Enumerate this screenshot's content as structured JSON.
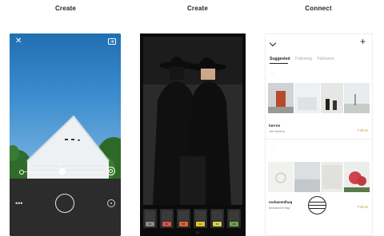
{
  "columns": {
    "create_1": "Create",
    "create_2": "Create",
    "connect": "Connect"
  },
  "camera": {
    "icons": [
      "close-icon",
      "switch-camera-icon",
      "more-dots-icon",
      "shutter-button",
      "settings-circle-icon"
    ],
    "more_label": "•••",
    "exposure_value": "0.0"
  },
  "editor": {
    "filters": [
      {
        "code": "A6",
        "color": "#8b8b8b"
      },
      {
        "code": "B1",
        "color": "#d9534f"
      },
      {
        "code": "B5",
        "color": "#e0623a"
      },
      {
        "code": "C1",
        "color": "#e6c52b"
      },
      {
        "code": "F2",
        "color": "#d8d24a"
      },
      {
        "code": "HB2",
        "color": "#6ea84d"
      }
    ]
  },
  "connect": {
    "tabs": [
      "Suggested",
      "Following",
      "Followers"
    ],
    "users": [
      {
        "username": "herron",
        "full_name": "Jon Herron",
        "action": "Follow"
      },
      {
        "username": "mohamedhaq",
        "full_name": "Mohamed Haq",
        "action": "Follow"
      }
    ],
    "accent": "#c8a048"
  }
}
